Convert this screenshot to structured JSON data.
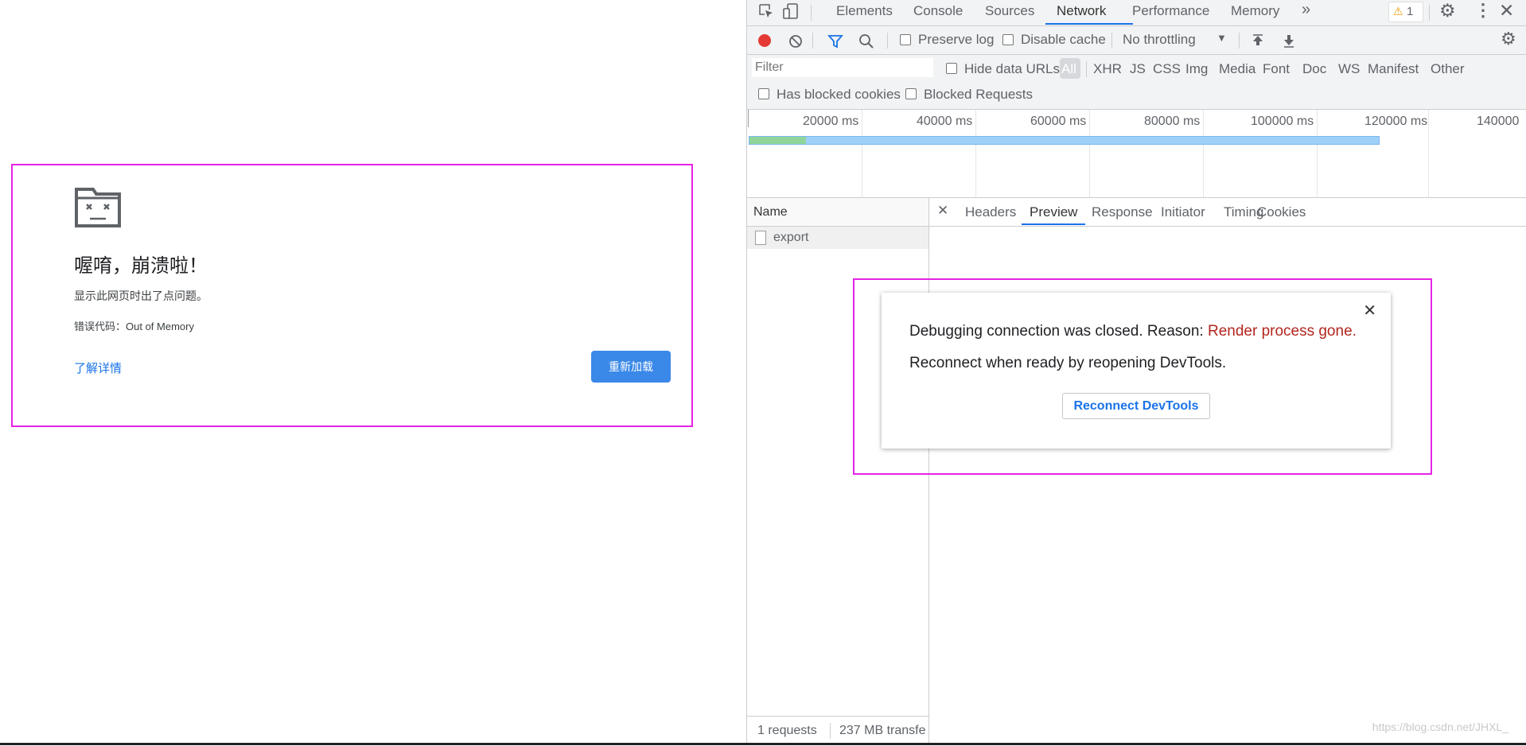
{
  "crash_page": {
    "title": "喔唷，崩溃啦！",
    "description": "显示此网页时出了点问题。",
    "error_code": "错误代码：Out of Memory",
    "learn_more": "了解详情",
    "reload": "重新加载"
  },
  "devtools": {
    "tabs": [
      "Elements",
      "Console",
      "Sources",
      "Network",
      "Performance",
      "Memory"
    ],
    "active_tab": "Network",
    "more_tabs": "»",
    "warning_count": "1",
    "toolbar": {
      "preserve_log": "Preserve log",
      "disable_cache": "Disable cache",
      "throttling": "No throttling"
    },
    "filter": {
      "placeholder": "Filter",
      "hide_data_urls": "Hide data URLs",
      "types": [
        "All",
        "XHR",
        "JS",
        "CSS",
        "Img",
        "Media",
        "Font",
        "Doc",
        "WS",
        "Manifest",
        "Other"
      ],
      "has_blocked_cookies": "Has blocked cookies",
      "blocked_requests": "Blocked Requests"
    },
    "timeline": {
      "ticks": [
        "20000 ms",
        "40000 ms",
        "60000 ms",
        "80000 ms",
        "100000 ms",
        "120000 ms",
        "140000"
      ]
    },
    "name_column": "Name",
    "requests": [
      "export"
    ],
    "detail_tabs": [
      "Headers",
      "Preview",
      "Response",
      "Initiator",
      "Timing",
      "Cookies"
    ],
    "active_detail_tab": "Preview",
    "status": {
      "requests": "1 requests",
      "transferred": "237 MB transfe"
    },
    "dialog": {
      "line1_prefix": "Debugging connection was closed. Reason: ",
      "reason": "Render process gone.",
      "line2": "Reconnect when ready by reopening DevTools.",
      "button": "Reconnect DevTools"
    }
  },
  "watermark": "https://blog.csdn.net/JHXL_",
  "colors": {
    "highlight": "#e623e6",
    "accent": "#1a73e8",
    "reload_button": "#3a88e8",
    "reason_text": "#b3261e"
  }
}
